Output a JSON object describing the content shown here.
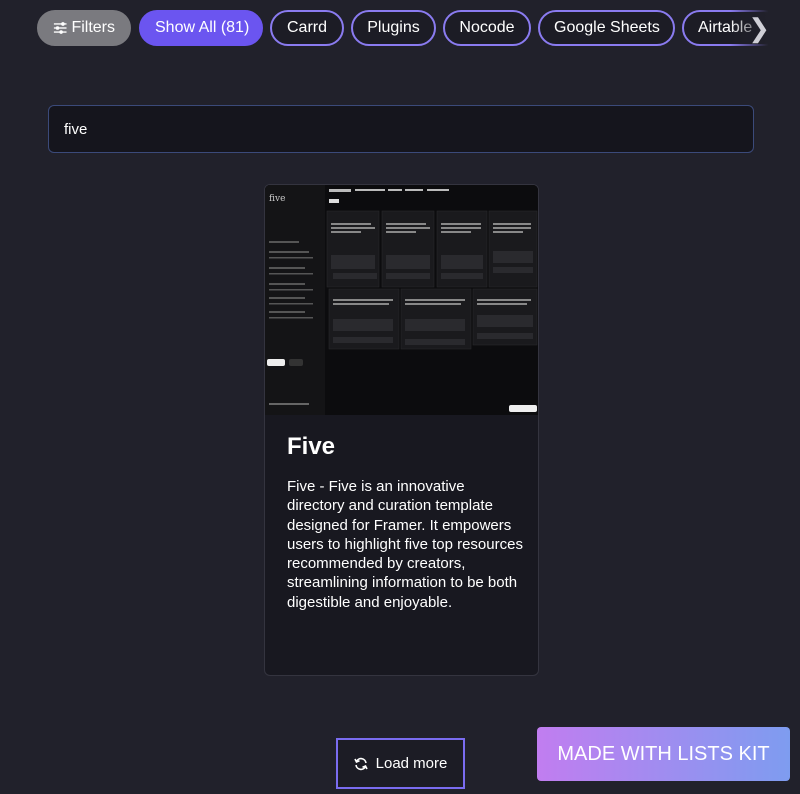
{
  "filters": {
    "button_label": "Filters",
    "chips": [
      "Show All (81)",
      "Carrd",
      "Plugins",
      "Nocode",
      "Google Sheets",
      "Airtable"
    ],
    "active_index": 0
  },
  "search": {
    "value": "five"
  },
  "card": {
    "thumbnail_logo": "five",
    "title": "Five",
    "description": "Five - Five is an innovative directory and curation template designed for Framer. It empowers users to highlight five top resources recommended by creators, streamlining information to be both digestible and enjoyable."
  },
  "load_more_label": "Load more",
  "made_with_label": "MADE WITH LISTS KIT"
}
